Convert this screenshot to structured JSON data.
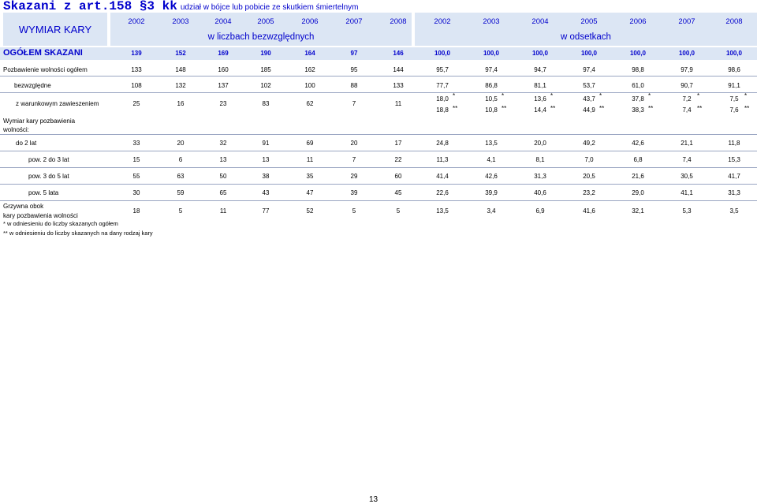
{
  "header": {
    "title": "Skazani z art.158 §3 kk",
    "subtitle": "udział w bójce lub pobicie ze skutkiem śmiertelnym"
  },
  "table": {
    "row_header_label": "WYMIAR KARY",
    "years": [
      "2002",
      "2003",
      "2004",
      "2005",
      "2006",
      "2007",
      "2008",
      "2002",
      "2003",
      "2004",
      "2005",
      "2006",
      "2007",
      "2008"
    ],
    "absolute_label": "w liczbach bezwzględnych",
    "percent_label": "w odsetkach",
    "total_row": {
      "label": "OGÓŁEM SKAZANI",
      "values": [
        "139",
        "152",
        "169",
        "190",
        "164",
        "97",
        "146",
        "100,0",
        "100,0",
        "100,0",
        "100,0",
        "100,0",
        "100,0",
        "100,0"
      ]
    },
    "rows": [
      {
        "label": "Pozbawienie wolności ogółem",
        "values": [
          "133",
          "148",
          "160",
          "185",
          "162",
          "95",
          "144",
          "95,7",
          "97,4",
          "94,7",
          "97,4",
          "98,8",
          "97,9",
          "98,6"
        ]
      },
      {
        "label": "bezwzględne",
        "values": [
          "108",
          "132",
          "137",
          "102",
          "100",
          "88",
          "133",
          "77,7",
          "86,8",
          "81,1",
          "53,7",
          "61,0",
          "90,7",
          "91,1"
        ]
      },
      {
        "label": "z warunkowym zawieszeniem",
        "values": [
          "25",
          "16",
          "23",
          "83",
          "62",
          "7",
          "11"
        ],
        "pct_star": [
          "18,0",
          "10,5",
          "13,6",
          "43,7",
          "37,8",
          "7,2",
          "7,5"
        ],
        "pct_dstar": [
          "18,8",
          "10,8",
          "14,4",
          "44,9",
          "38,3",
          "7,4",
          "7,6"
        ],
        "star": "*",
        "dstar": "**"
      },
      {
        "label": "Wymiar kary pozbawienia wolności:"
      },
      {
        "label": "do 2 lat",
        "values": [
          "33",
          "20",
          "32",
          "91",
          "69",
          "20",
          "17",
          "24,8",
          "13,5",
          "20,0",
          "49,2",
          "42,6",
          "21,1",
          "11,8"
        ]
      },
      {
        "label": "pow. 2 do 3 lat",
        "values": [
          "15",
          "6",
          "13",
          "13",
          "11",
          "7",
          "22",
          "11,3",
          "4,1",
          "8,1",
          "7,0",
          "6,8",
          "7,4",
          "15,3"
        ]
      },
      {
        "label": "pow. 3 do 5 lat",
        "values": [
          "55",
          "63",
          "50",
          "38",
          "35",
          "29",
          "60",
          "41,4",
          "42,6",
          "31,3",
          "20,5",
          "21,6",
          "30,5",
          "41,7"
        ]
      },
      {
        "label": "pow. 5 lata",
        "values": [
          "30",
          "59",
          "65",
          "43",
          "47",
          "39",
          "45",
          "22,6",
          "39,9",
          "40,6",
          "23,2",
          "29,0",
          "41,1",
          "31,3"
        ]
      },
      {
        "label_line1": "Grzywna obok",
        "label_line2": "kary pozbawienia wolności",
        "values": [
          "18",
          "5",
          "11",
          "77",
          "52",
          "5",
          "5",
          "13,5",
          "3,4",
          "6,9",
          "41,6",
          "32,1",
          "5,3",
          "3,5"
        ]
      }
    ]
  },
  "footnotes": [
    "* w odniesieniu do liczby skazanych ogółem",
    "** w odniesieniu do liczby skazanych na dany rodzaj kary"
  ],
  "page_number": "13"
}
